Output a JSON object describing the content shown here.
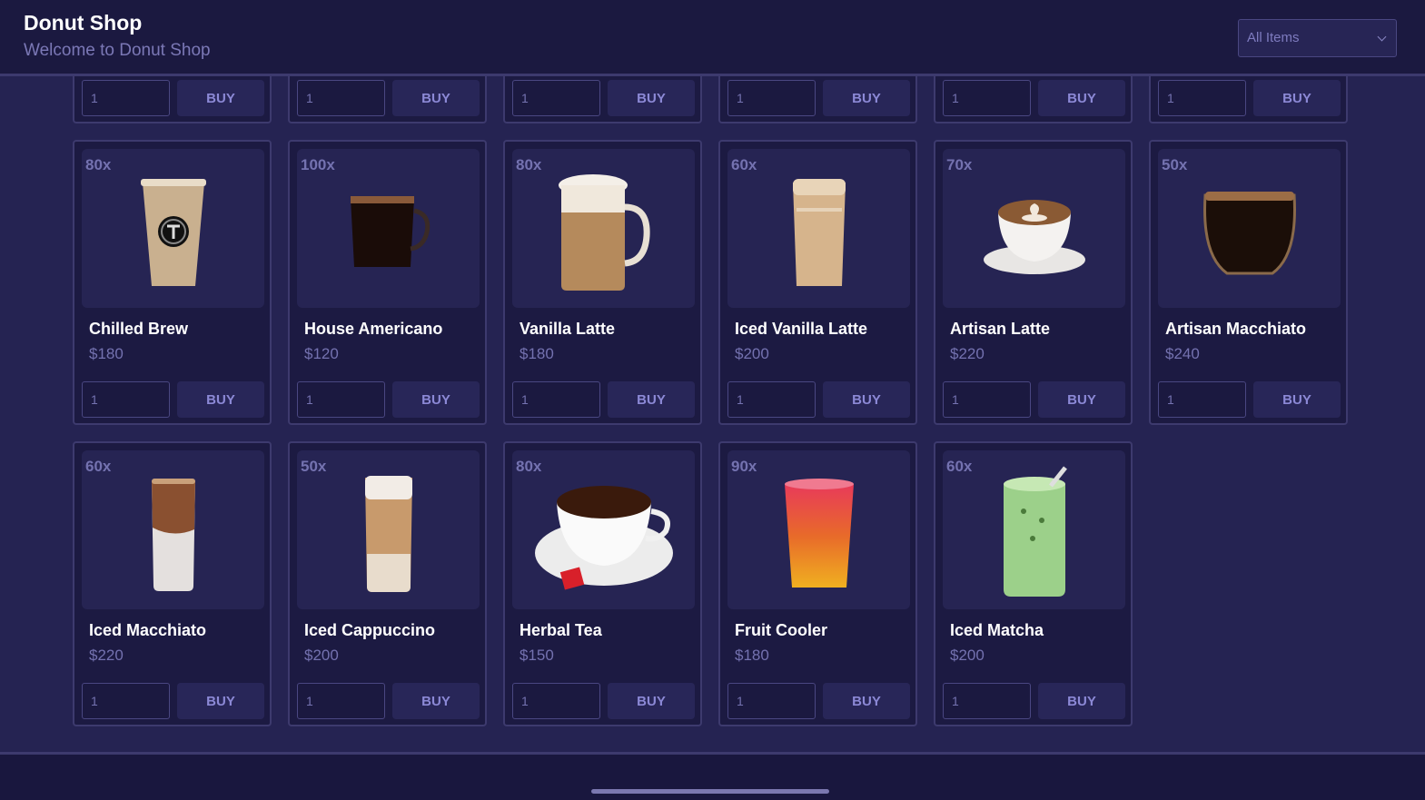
{
  "header": {
    "title": "Donut Shop",
    "subtitle": "Welcome to Donut Shop"
  },
  "filter": {
    "selected": "All Items"
  },
  "products_row_top_partial": [
    {
      "qty": "1",
      "buy_label": "BUY"
    },
    {
      "qty": "1",
      "buy_label": "BUY"
    },
    {
      "qty": "1",
      "buy_label": "BUY"
    },
    {
      "qty": "1",
      "buy_label": "BUY"
    },
    {
      "qty": "1",
      "buy_label": "BUY"
    },
    {
      "qty": "1",
      "buy_label": "BUY"
    }
  ],
  "products": [
    {
      "name": "Chilled Brew",
      "price": "$180",
      "stock": "80x",
      "qty": "1",
      "buy_label": "BUY",
      "image": "iced-coffee-cup"
    },
    {
      "name": "House Americano",
      "price": "$120",
      "stock": "100x",
      "qty": "1",
      "buy_label": "BUY",
      "image": "black-coffee-mug"
    },
    {
      "name": "Vanilla Latte",
      "price": "$180",
      "stock": "80x",
      "qty": "1",
      "buy_label": "BUY",
      "image": "latte-mug"
    },
    {
      "name": "Iced Vanilla Latte",
      "price": "$200",
      "stock": "60x",
      "qty": "1",
      "buy_label": "BUY",
      "image": "iced-latte-glass"
    },
    {
      "name": "Artisan Latte",
      "price": "$220",
      "stock": "70x",
      "qty": "1",
      "buy_label": "BUY",
      "image": "latte-art-cup"
    },
    {
      "name": "Artisan Macchiato",
      "price": "$240",
      "stock": "50x",
      "qty": "1",
      "buy_label": "BUY",
      "image": "espresso-glass"
    },
    {
      "name": "Iced Macchiato",
      "price": "$220",
      "stock": "60x",
      "qty": "1",
      "buy_label": "BUY",
      "image": "iced-macchiato-glass"
    },
    {
      "name": "Iced Cappuccino",
      "price": "$200",
      "stock": "50x",
      "qty": "1",
      "buy_label": "BUY",
      "image": "iced-cappuccino-glass"
    },
    {
      "name": "Herbal Tea",
      "price": "$150",
      "stock": "80x",
      "qty": "1",
      "buy_label": "BUY",
      "image": "tea-cup"
    },
    {
      "name": "Fruit Cooler",
      "price": "$180",
      "stock": "90x",
      "qty": "1",
      "buy_label": "BUY",
      "image": "fruit-slush-glass"
    },
    {
      "name": "Iced Matcha",
      "price": "$200",
      "stock": "60x",
      "qty": "1",
      "buy_label": "BUY",
      "image": "matcha-glass"
    }
  ]
}
